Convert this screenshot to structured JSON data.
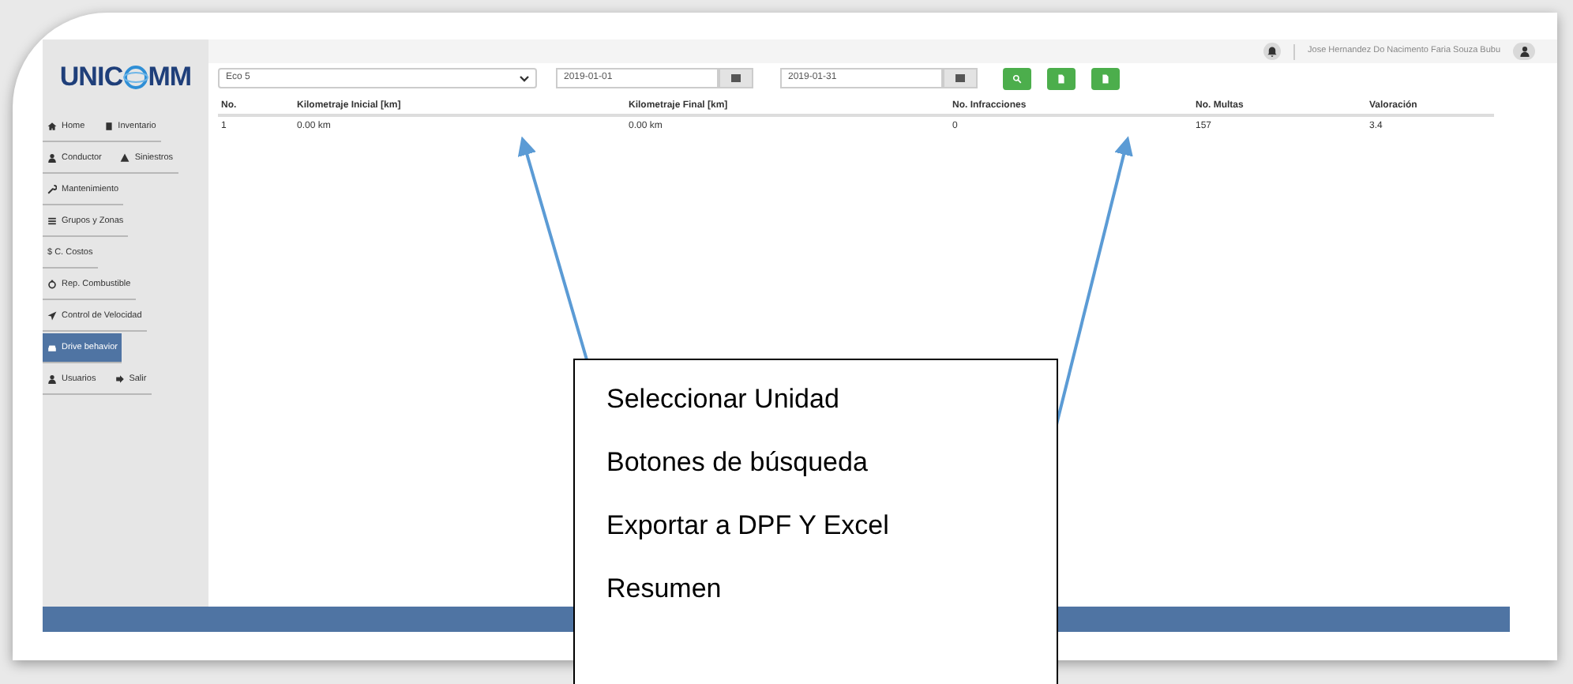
{
  "logo": {
    "parts": [
      "UNIC",
      "MM"
    ]
  },
  "sidebar": {
    "rows": [
      [
        {
          "kind": "home",
          "label": "Home",
          "selected": false
        },
        {
          "kind": "inventory",
          "label": "Inventario",
          "selected": false
        }
      ],
      [
        {
          "kind": "driver",
          "label": "Conductor",
          "selected": false
        },
        {
          "kind": "incident",
          "label": "Siniestros",
          "selected": false
        }
      ],
      [
        {
          "kind": "maintenance",
          "label": "Mantenimiento",
          "selected": false
        }
      ],
      [
        {
          "kind": "groups",
          "label": "Grupos y Zonas",
          "selected": false
        }
      ],
      [
        {
          "kind": "costs",
          "label": "$ C. Costos",
          "selected": false
        }
      ],
      [
        {
          "kind": "fuel",
          "label": "Rep. Combustible",
          "selected": false
        }
      ],
      [
        {
          "kind": "speed",
          "label": "Control de Velocidad",
          "selected": false
        }
      ],
      [
        {
          "kind": "behavior",
          "label": "Drive behavior",
          "selected": true
        }
      ],
      [
        {
          "kind": "users",
          "label": "Usuarios",
          "selected": false
        },
        {
          "kind": "logout",
          "label": "Salir",
          "selected": false
        }
      ]
    ]
  },
  "topbar": {
    "user_name": "Jose Hernandez Do Nacimento Faria Souza Bubu"
  },
  "filters": {
    "unit": "Eco 5",
    "date_from": "2019-01-01",
    "date_to": "2019-01-31",
    "buttons": [
      {
        "kind": "search"
      },
      {
        "kind": "export"
      },
      {
        "kind": "export"
      }
    ]
  },
  "table": {
    "columns": [
      "No.",
      "Kilometraje Inicial [km]",
      "Kilometraje Final [km]",
      "No. Infracciones",
      "No. Multas",
      "Valoración"
    ],
    "rows": [
      [
        "1",
        "0.00 km",
        "0.00 km",
        "0",
        "157",
        "3.4"
      ]
    ]
  },
  "callout": {
    "lines": [
      "Seleccionar Unidad",
      "Botones de búsqueda",
      "Exportar a DPF Y Excel",
      "Resumen"
    ]
  }
}
